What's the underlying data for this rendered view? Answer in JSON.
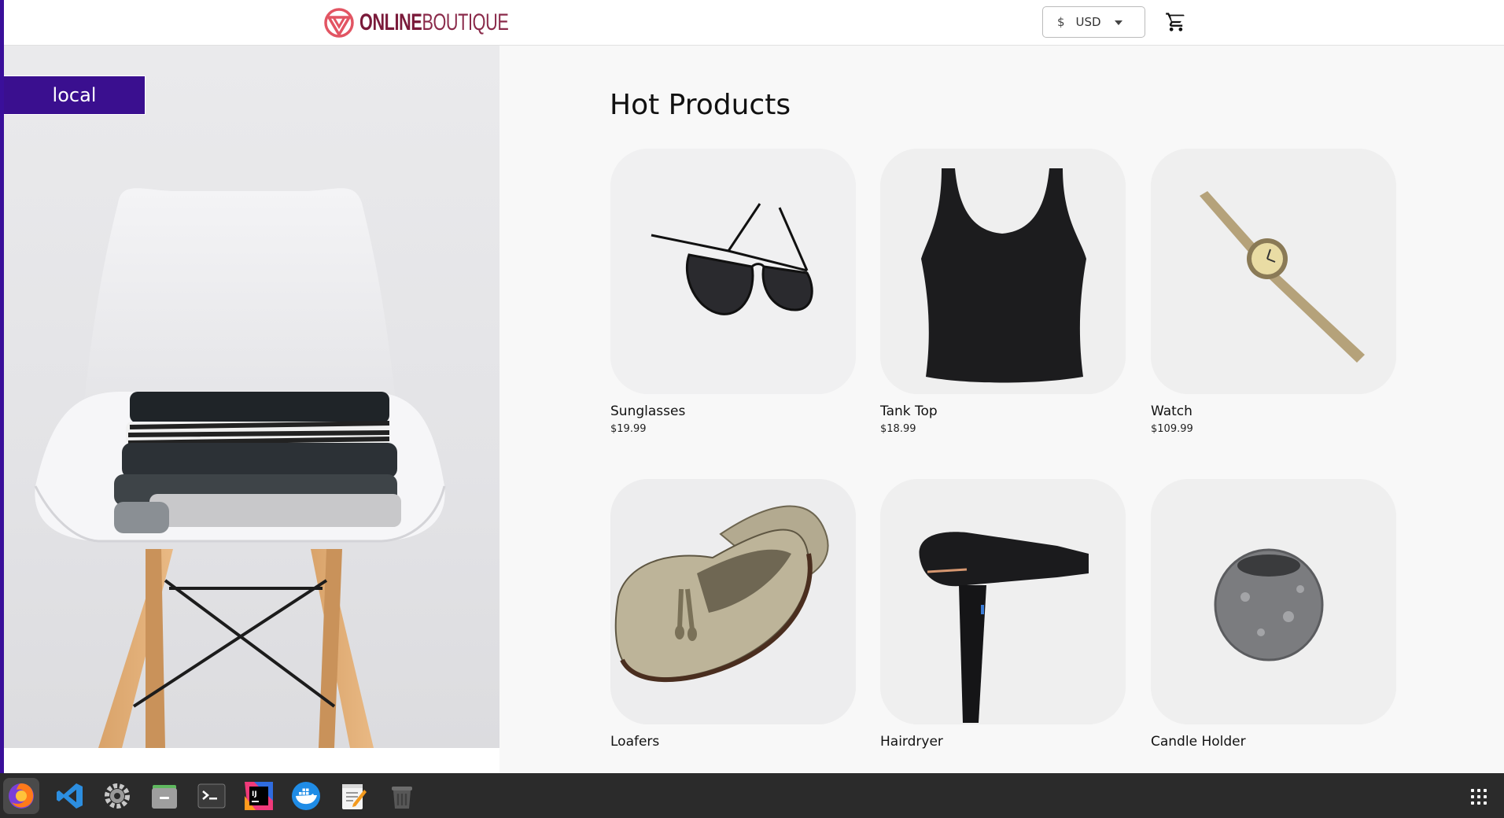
{
  "header": {
    "logo": {
      "bold": "ONLINE",
      "light": "BOUTIQUE"
    },
    "currency": {
      "symbol": "$",
      "code": "USD"
    }
  },
  "hero": {
    "env_badge": "local"
  },
  "main": {
    "section_title": "Hot Products",
    "products": [
      {
        "name": "Sunglasses",
        "price": "$19.99"
      },
      {
        "name": "Tank Top",
        "price": "$18.99"
      },
      {
        "name": "Watch",
        "price": "$109.99"
      },
      {
        "name": "Loafers",
        "price": ""
      },
      {
        "name": "Hairdryer",
        "price": ""
      },
      {
        "name": "Candle Holder",
        "price": ""
      }
    ]
  },
  "taskbar": {
    "apps": [
      "firefox-icon",
      "vscode-icon",
      "settings-icon",
      "files-icon",
      "terminal-icon",
      "intellij-icon",
      "docker-icon",
      "text-editor-icon",
      "trash-icon"
    ]
  },
  "colors": {
    "accent": "#3a0f8f",
    "logo": "#7a1a3a",
    "taskbar": "#2b2b2b"
  }
}
